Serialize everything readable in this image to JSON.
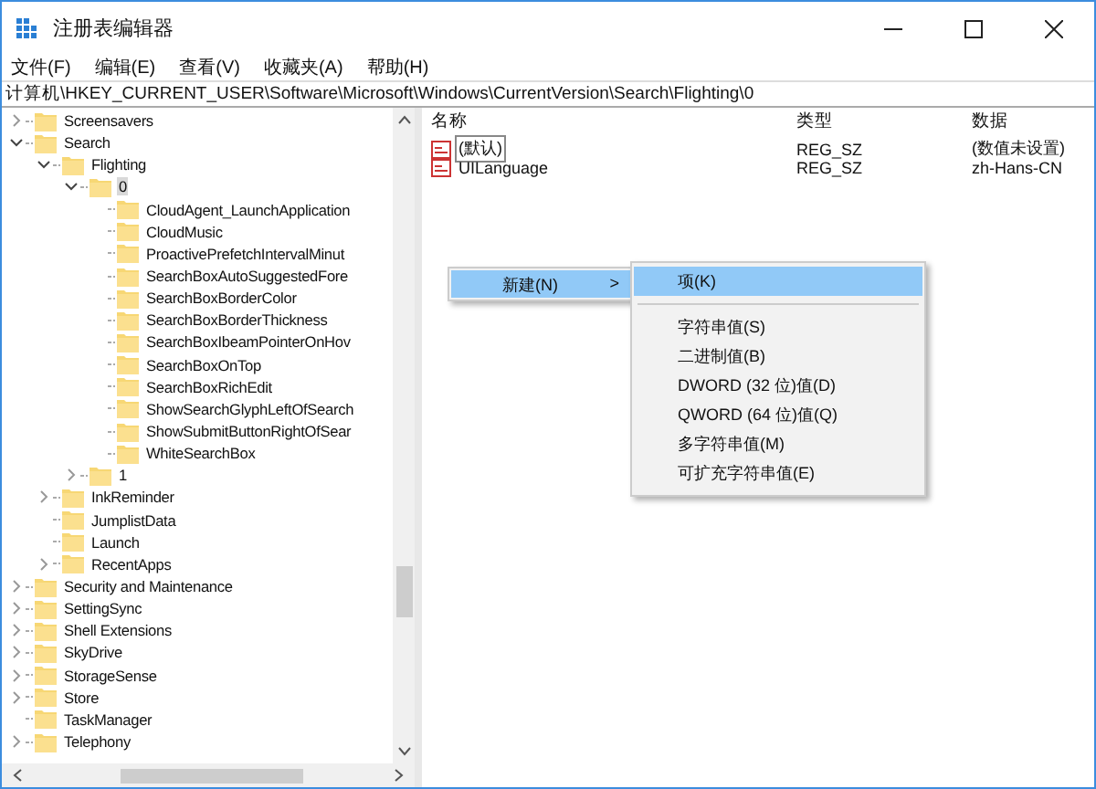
{
  "window": {
    "title": "注册表编辑器"
  },
  "menu": [
    "文件(F)",
    "编辑(E)",
    "查看(V)",
    "收藏夹(A)",
    "帮助(H)"
  ],
  "address": "计算机\\HKEY_CURRENT_USER\\Software\\Microsoft\\Windows\\CurrentVersion\\Search\\Flighting\\0",
  "tree": [
    {
      "label": "Screensavers",
      "expandable": true,
      "expanded": false,
      "selected": false
    },
    {
      "label": "Search",
      "expandable": true,
      "expanded": true,
      "selected": false,
      "children": [
        {
          "label": "Flighting",
          "expandable": true,
          "expanded": true,
          "selected": false,
          "children": [
            {
              "label": "0",
              "expandable": true,
              "expanded": true,
              "selected": true,
              "children": [
                {
                  "label": "CloudAgent_LaunchApplication",
                  "expandable": false,
                  "selected": false
                },
                {
                  "label": "CloudMusic",
                  "expandable": false,
                  "selected": false
                },
                {
                  "label": "ProactivePrefetchIntervalMinut",
                  "expandable": false,
                  "selected": false
                },
                {
                  "label": "SearchBoxAutoSuggestedFore",
                  "expandable": false,
                  "selected": false
                },
                {
                  "label": "SearchBoxBorderColor",
                  "expandable": false,
                  "selected": false
                },
                {
                  "label": "SearchBoxBorderThickness",
                  "expandable": false,
                  "selected": false
                },
                {
                  "label": "SearchBoxIbeamPointerOnHov",
                  "expandable": false,
                  "selected": false
                },
                {
                  "label": "SearchBoxOnTop",
                  "expandable": false,
                  "selected": false
                },
                {
                  "label": "SearchBoxRichEdit",
                  "expandable": false,
                  "selected": false
                },
                {
                  "label": "ShowSearchGlyphLeftOfSearch",
                  "expandable": false,
                  "selected": false
                },
                {
                  "label": "ShowSubmitButtonRightOfSear",
                  "expandable": false,
                  "selected": false
                },
                {
                  "label": "WhiteSearchBox",
                  "expandable": false,
                  "selected": false
                }
              ]
            },
            {
              "label": "1",
              "expandable": true,
              "expanded": false,
              "selected": false
            }
          ]
        },
        {
          "label": "InkReminder",
          "expandable": true,
          "expanded": false,
          "selected": false
        },
        {
          "label": "JumplistData",
          "expandable": false,
          "selected": false
        },
        {
          "label": "Launch",
          "expandable": false,
          "selected": false
        },
        {
          "label": "RecentApps",
          "expandable": true,
          "expanded": false,
          "selected": false
        }
      ]
    },
    {
      "label": "Security and Maintenance",
      "expandable": true,
      "expanded": false,
      "selected": false
    },
    {
      "label": "SettingSync",
      "expandable": true,
      "expanded": false,
      "selected": false
    },
    {
      "label": "Shell Extensions",
      "expandable": true,
      "expanded": false,
      "selected": false
    },
    {
      "label": "SkyDrive",
      "expandable": true,
      "expanded": false,
      "selected": false
    },
    {
      "label": "StorageSense",
      "expandable": true,
      "expanded": false,
      "selected": false
    },
    {
      "label": "Store",
      "expandable": true,
      "expanded": false,
      "selected": false
    },
    {
      "label": "TaskManager",
      "expandable": false,
      "selected": false
    },
    {
      "label": "Telephony",
      "expandable": true,
      "expanded": false,
      "selected": false
    }
  ],
  "values": {
    "columns": [
      "名称",
      "类型",
      "数据"
    ],
    "rows": [
      {
        "name": "(默认)",
        "type": "REG_SZ",
        "data": "(数值未设置)",
        "focused": true
      },
      {
        "name": "UILanguage",
        "type": "REG_SZ",
        "data": "zh-Hans-CN",
        "focused": false
      }
    ]
  },
  "context_menu": {
    "items": [
      {
        "label": "新建(N)",
        "arrow": ">",
        "selected": true
      }
    ],
    "submenu": [
      {
        "label": "项(K)",
        "selected": true,
        "separator_after": true
      },
      {
        "label": "字符串值(S)",
        "selected": false,
        "separator_after": false
      },
      {
        "label": "二进制值(B)",
        "selected": false,
        "separator_after": false
      },
      {
        "label": "DWORD (32 位)值(D)",
        "selected": false,
        "separator_after": false
      },
      {
        "label": "QWORD (64 位)值(Q)",
        "selected": false,
        "separator_after": false
      },
      {
        "label": "多字符串值(M)",
        "selected": false,
        "separator_after": false
      },
      {
        "label": "可扩充字符串值(E)",
        "selected": false,
        "separator_after": false
      }
    ]
  }
}
